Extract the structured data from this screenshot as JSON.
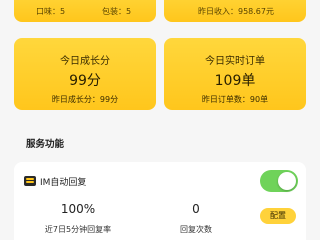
{
  "top_cards": {
    "left": {
      "taste": "口味：5",
      "packaging": "包装：5"
    },
    "right": {
      "yesterday_income": "昨日收入：958.67元"
    }
  },
  "growth_card": {
    "title": "今日成长分",
    "value": "99分",
    "footer": "昨日成长分：99分"
  },
  "orders_card": {
    "title": "今日实时订单",
    "value": "109单",
    "footer": "昨日订单数：90单"
  },
  "services": {
    "section_title": "服务功能",
    "im_reply": {
      "label": "IM自动回复",
      "toggle_on": true,
      "reply_rate_value": "100%",
      "reply_rate_label": "近7日5分钟回复率",
      "reply_count_value": "0",
      "reply_count_label": "回复次数",
      "config_label": "配置"
    }
  },
  "colors": {
    "card_yellow": "#ffc61c",
    "toggle_green": "#6fd35a",
    "background": "#f6f6f6"
  }
}
